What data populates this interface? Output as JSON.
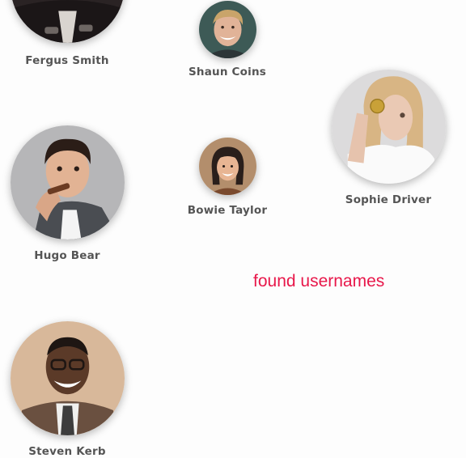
{
  "people": [
    {
      "key": "fergus",
      "name": "Fergus Smith",
      "avatar_icon": "person-photo"
    },
    {
      "key": "shaun",
      "name": "Shaun Coins",
      "avatar_icon": "person-photo"
    },
    {
      "key": "sophie",
      "name": "Sophie Driver",
      "avatar_icon": "person-photo"
    },
    {
      "key": "hugo",
      "name": "Hugo Bear",
      "avatar_icon": "person-photo"
    },
    {
      "key": "bowie",
      "name": "Bowie Taylor",
      "avatar_icon": "person-photo"
    },
    {
      "key": "steven",
      "name": "Steven Kerb",
      "avatar_icon": "person-photo"
    }
  ],
  "status_text": "found usernames",
  "colors": {
    "accent": "#e8174a",
    "name_text": "#555555",
    "background": "#fdfdfd"
  }
}
